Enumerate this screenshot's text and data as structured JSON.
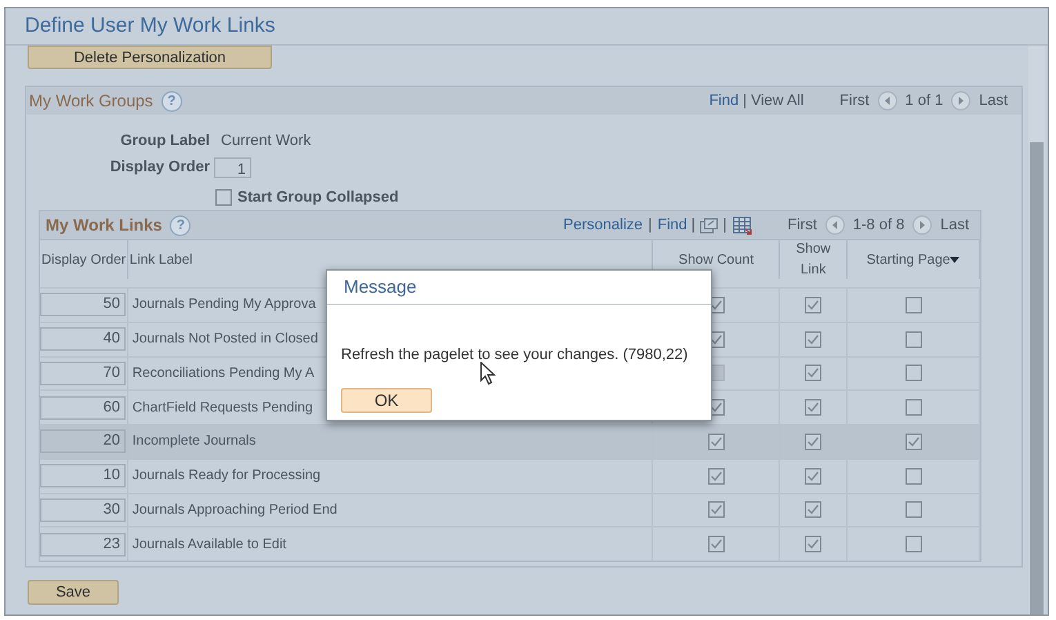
{
  "window": {
    "title": "Define User My Work Links"
  },
  "delete_button": "Delete Personalization",
  "work_groups": {
    "title": "My Work Groups",
    "help": "?",
    "find": "Find",
    "separator": "|",
    "view_all": "View All",
    "first": "First",
    "range": "1 of 1",
    "last": "Last",
    "group_label": {
      "label": "Group Label",
      "value": "Current Work"
    },
    "display_order": {
      "label": "Display Order",
      "value": "1"
    },
    "start_collapsed": {
      "label": "Start Group Collapsed",
      "checked": false
    }
  },
  "work_links": {
    "title": "My Work Links",
    "help": "?",
    "personalize": "Personalize",
    "find": "Find",
    "separators": [
      "|",
      "|",
      "|"
    ],
    "first": "First",
    "range": "1-8 of 8",
    "last": "Last",
    "columns": [
      "Display Order",
      "Link Label",
      "Show Count",
      "Show Link",
      "Starting Page"
    ],
    "rows": [
      {
        "order": "50",
        "label": "Journals Pending My Approva",
        "show_count": true,
        "show_count_disabled": false,
        "show_link": true,
        "starting_page": false,
        "selected": false
      },
      {
        "order": "40",
        "label": "Journals Not Posted in Closed",
        "show_count": true,
        "show_count_disabled": false,
        "show_link": true,
        "starting_page": false,
        "selected": false
      },
      {
        "order": "70",
        "label": "Reconciliations Pending My A",
        "show_count": false,
        "show_count_disabled": true,
        "show_link": true,
        "starting_page": false,
        "selected": false
      },
      {
        "order": "60",
        "label": "ChartField Requests Pending",
        "show_count": true,
        "show_count_disabled": false,
        "show_link": true,
        "starting_page": false,
        "selected": false
      },
      {
        "order": "20",
        "label": "Incomplete Journals",
        "show_count": true,
        "show_count_disabled": false,
        "show_link": true,
        "starting_page": true,
        "selected": true
      },
      {
        "order": "10",
        "label": "Journals Ready for Processing",
        "show_count": true,
        "show_count_disabled": false,
        "show_link": true,
        "starting_page": false,
        "selected": false
      },
      {
        "order": "30",
        "label": "Journals Approaching Period End",
        "show_count": true,
        "show_count_disabled": false,
        "show_link": true,
        "starting_page": false,
        "selected": false
      },
      {
        "order": "23",
        "label": "Journals Available to Edit",
        "show_count": true,
        "show_count_disabled": false,
        "show_link": true,
        "starting_page": false,
        "selected": false
      }
    ]
  },
  "save_button": "Save",
  "dialog": {
    "title": "Message",
    "text": "Refresh the pagelet to see your changes. (7980,22)",
    "ok": "OK"
  }
}
